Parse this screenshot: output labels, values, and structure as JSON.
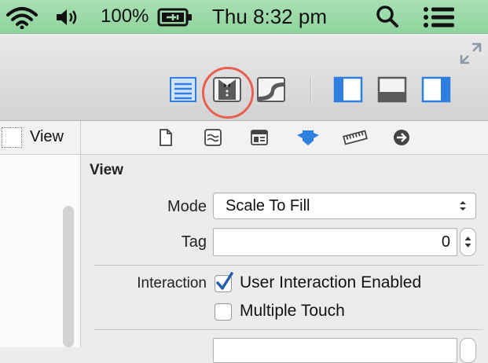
{
  "menubar": {
    "battery": "100%",
    "clock": "Thu 8:32 pm"
  },
  "navigator": {
    "item_label": "View"
  },
  "inspector": {
    "section_title": "View",
    "mode": {
      "label": "Mode",
      "value": "Scale To Fill"
    },
    "tag": {
      "label": "Tag",
      "value": "0"
    },
    "interaction": {
      "label": "Interaction",
      "options": [
        {
          "label": "User Interaction Enabled",
          "checked": true
        },
        {
          "label": "Multiple Touch",
          "checked": false
        }
      ]
    }
  },
  "colors": {
    "menubar_green": "#a3dcae",
    "accent_blue": "#2f7fe0",
    "highlight_ring": "#e8604f"
  }
}
